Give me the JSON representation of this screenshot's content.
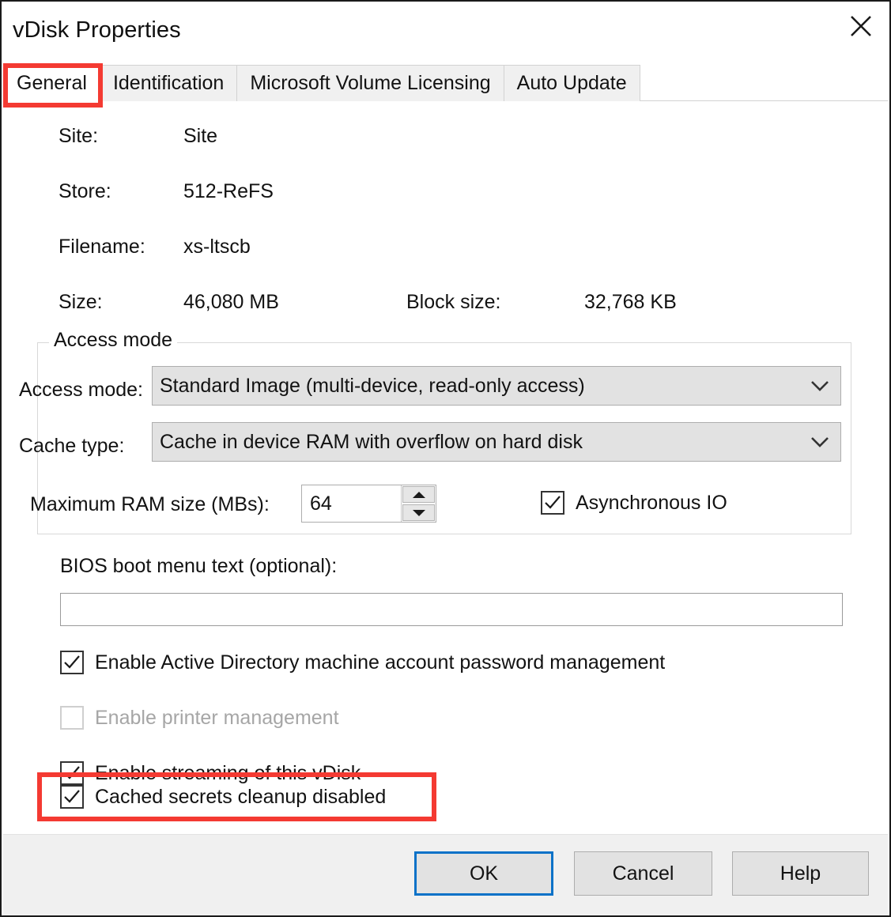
{
  "window": {
    "title": "vDisk Properties",
    "close_icon": "close-icon"
  },
  "tabs": [
    {
      "label": "General",
      "active": true
    },
    {
      "label": "Identification",
      "active": false
    },
    {
      "label": "Microsoft Volume Licensing",
      "active": false
    },
    {
      "label": "Auto Update",
      "active": false
    }
  ],
  "general": {
    "site": {
      "label": "Site:",
      "value": "Site"
    },
    "store": {
      "label": "Store:",
      "value": "512-ReFS"
    },
    "filename": {
      "label": "Filename:",
      "value": "xs-ltscb"
    },
    "size": {
      "label": "Size:",
      "value": "46,080 MB"
    },
    "block_size": {
      "label": "Block size:",
      "value": "32,768 KB"
    }
  },
  "access_mode_group": {
    "legend": "Access mode",
    "access_mode": {
      "label": "Access mode:",
      "value": "Standard Image (multi-device, read-only access)",
      "chevron": "chevron-down-icon"
    },
    "cache_type": {
      "label": "Cache type:",
      "value": "Cache in device RAM with overflow on hard disk",
      "chevron": "chevron-down-icon"
    },
    "max_ram": {
      "label": "Maximum RAM size (MBs):",
      "value": "64"
    },
    "async_io": {
      "label": "Asynchronous IO",
      "checked": true
    }
  },
  "bios": {
    "label": "BIOS boot menu text (optional):",
    "value": "",
    "placeholder": ""
  },
  "checkboxes": [
    {
      "label": "Enable Active Directory machine account password management",
      "checked": true,
      "disabled": false
    },
    {
      "label": "Enable printer management",
      "checked": false,
      "disabled": true
    },
    {
      "label": "Enable streaming of this vDisk",
      "checked": true,
      "disabled": false
    },
    {
      "label": "Cached secrets cleanup disabled",
      "checked": true,
      "disabled": false
    }
  ],
  "footer": {
    "ok": "OK",
    "cancel": "Cancel",
    "help": "Help"
  },
  "colors": {
    "annotation": "#f43a32",
    "default_button_focus": "#0a72c8",
    "control_fill": "#e2e2e2",
    "footer_bg": "#f0f0f0",
    "text": "#121212",
    "disabled_text": "#a6a6a6"
  }
}
